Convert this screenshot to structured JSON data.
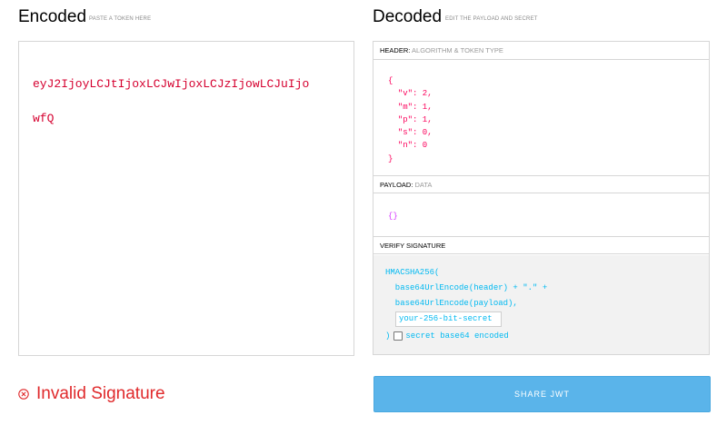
{
  "encoded": {
    "title": "Encoded",
    "subtitle": "PASTE A TOKEN HERE",
    "token_line1": "eyJ2IjoyLCJtIjoxLCJwIjoxLCJzIjowLCJuIjo",
    "token_line2": "wfQ"
  },
  "decoded": {
    "title": "Decoded",
    "subtitle": "EDIT THE PAYLOAD AND SECRET",
    "header": {
      "label": "HEADER:",
      "hint": "ALGORITHM & TOKEN TYPE",
      "lines": [
        "{",
        "  \"v\": 2,",
        "  \"m\": 1,",
        "  \"p\": 1,",
        "  \"s\": 0,",
        "  \"n\": 0",
        "}"
      ]
    },
    "payload": {
      "label": "PAYLOAD:",
      "hint": "DATA",
      "content": "{}"
    },
    "verify": {
      "label": "VERIFY SIGNATURE",
      "line1": "HMACSHA256(",
      "line2": "  base64UrlEncode(header) + \".\" +",
      "line3": "  base64UrlEncode(payload),",
      "secret_value": "your-256-bit-secret",
      "close_paren": ")",
      "checkbox_label": "secret base64 encoded"
    }
  },
  "status": {
    "text": "Invalid Signature",
    "color": "#e0292b"
  },
  "share_button": {
    "label": "SHARE JWT",
    "color": "#5ab4ea"
  }
}
